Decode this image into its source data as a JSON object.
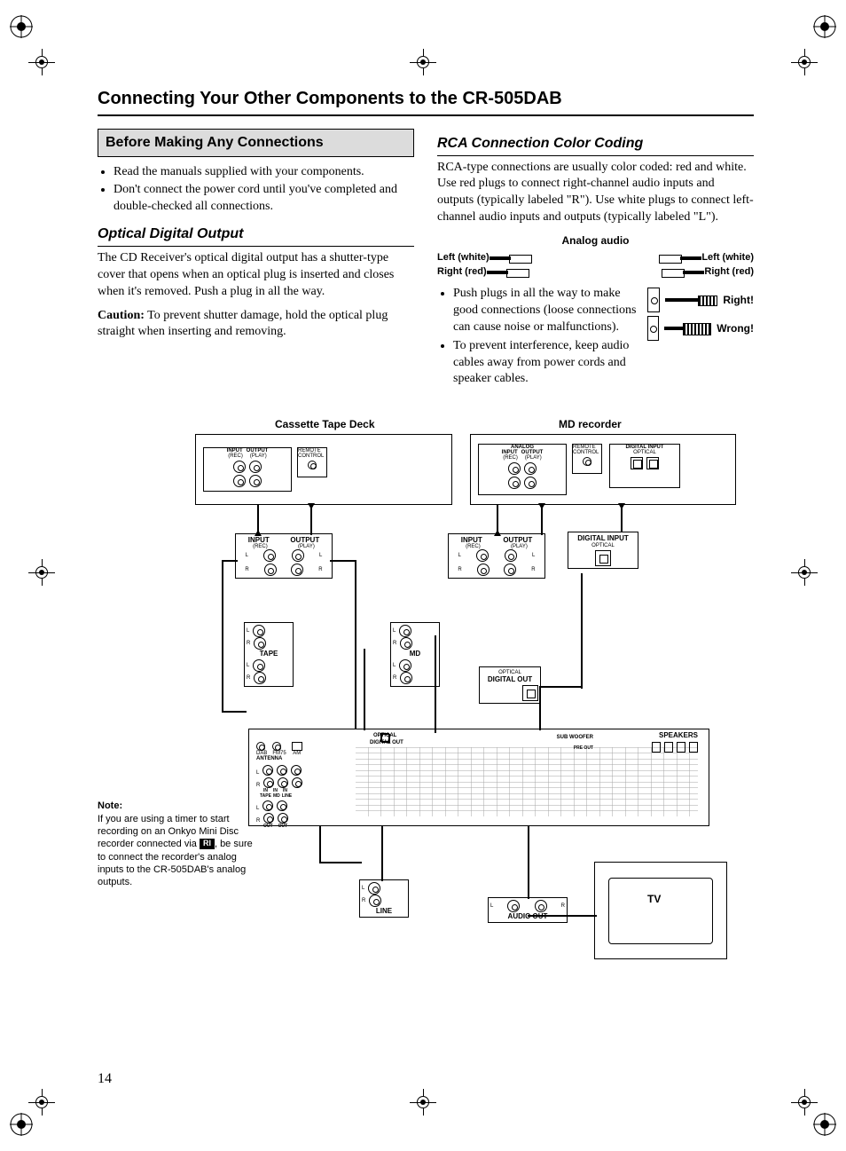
{
  "page_number": "14",
  "title": "Connecting Your Other Components to the CR-505DAB",
  "left": {
    "boxed_heading": "Before Making Any Connections",
    "bullets": [
      "Read the manuals supplied with your components.",
      "Don't connect the power cord until you've completed and double-checked all connections."
    ],
    "sub1_heading": "Optical Digital Output",
    "sub1_p1": "The CD Receiver's optical digital output has a shutter-type cover that opens when an optical plug is inserted and closes when it's removed. Push a plug in all the way.",
    "sub1_caution_label": "Caution:",
    "sub1_caution_text": " To prevent shutter damage, hold the optical plug straight when inserting and removing."
  },
  "right": {
    "sub_heading": "RCA Connection Color Coding",
    "p1": "RCA-type connections are usually color coded: red and white. Use red plugs to connect right-channel audio inputs and outputs (typically labeled \"R\"). Use white plugs to connect left-channel audio inputs and outputs (typically labeled \"L\").",
    "analog_title": "Analog audio",
    "left_white": "Left (white)",
    "right_red": "Right (red)",
    "push_bullets": [
      "Push plugs in all the way to make good connections (loose connections can cause noise or malfunctions).",
      "To prevent interference, keep audio cables away from power cords and speaker cables."
    ],
    "right_label": "Right!",
    "wrong_label": "Wrong!"
  },
  "diagram": {
    "cassette_title": "Cassette Tape Deck",
    "md_title": "MD recorder",
    "tv_label": "TV",
    "blocks": {
      "input_rec": "INPUT",
      "output_play": "OUTPUT",
      "rec": "(REC)",
      "play": "(PLAY)",
      "analog": "ANALOG",
      "remote_control": "REMOTE CONTROL",
      "digital_input": "DIGITAL INPUT",
      "optical": "OPTICAL",
      "digital_out": "DIGITAL OUT",
      "tape": "TAPE",
      "md": "MD",
      "line": "LINE",
      "l": "L",
      "r": "R",
      "audio_out": "AUDIO OUT",
      "speakers": "SPEAKERS",
      "subwoofer": "SUB WOOFER",
      "pre_out": "PRE OUT",
      "antenna": "ANTENNA",
      "dab": "DAB",
      "fm75": "FM75",
      "am": "AM",
      "in": "IN",
      "out": "OUT"
    },
    "note_title": "Note:",
    "note_text_before": "If you are using a timer to start recording on an Onkyo Mini Disc recorder connected via ",
    "note_text_after": ", be sure to connect the recorder's analog inputs to the CR-505DAB's analog outputs.",
    "ri": "RI"
  }
}
